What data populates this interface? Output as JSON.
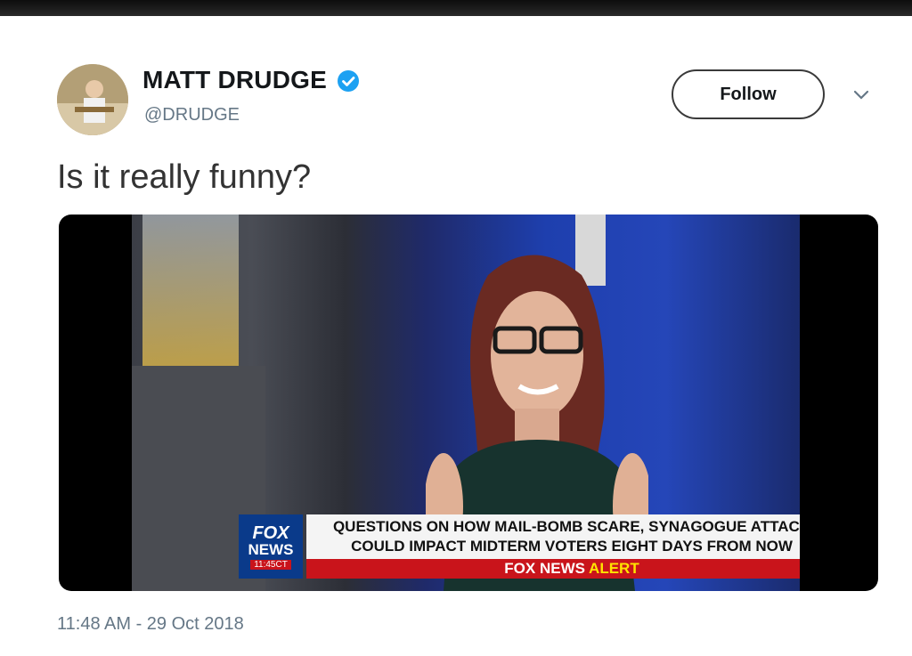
{
  "tweet": {
    "author_name": "MATT DRUDGE",
    "handle": "@DRUDGE",
    "follow_label": "Follow",
    "text": "Is it really funny?",
    "timestamp": "11:48 AM - 29 Oct 2018"
  },
  "media": {
    "chyron_line1": "QUESTIONS ON HOW MAIL-BOMB SCARE, SYNAGOGUE ATTACK",
    "chyron_line2": "COULD IMPACT MIDTERM VOTERS EIGHT DAYS FROM NOW",
    "logo_top": "FOX",
    "logo_bottom": "NEWS",
    "clock": "11:45CT",
    "alert_prefix": "FOX NEWS",
    "alert_word": "ALERT"
  },
  "colors": {
    "verified_blue": "#1da1f2",
    "fox_red": "#c9141b",
    "fox_blue": "#0a3a8a"
  },
  "icons": [
    "verified-badge-icon",
    "chevron-down-icon"
  ]
}
